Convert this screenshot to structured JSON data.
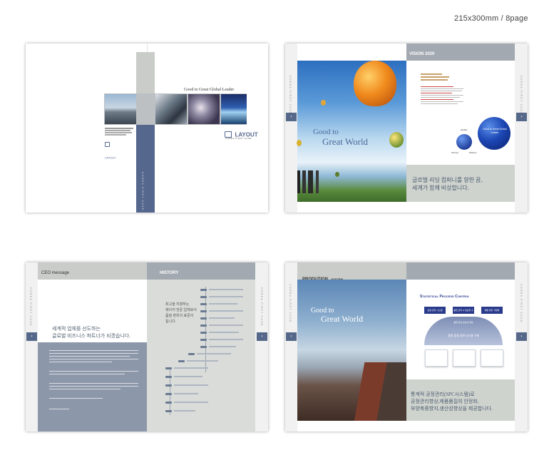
{
  "spec_label": "215x300mm / 8page",
  "cover": {
    "headline": "Good to Great Global Leader",
    "logo": "LAYOUT",
    "logo_sub": "KOREA FIRST CASE",
    "accent": "#4f5f86"
  },
  "vision": {
    "tab": "VISION 2020",
    "hero_line1": "Good to",
    "hero_line2": "Great World",
    "tagline_line1": "글로벌 리딩 컴퍼니를 향한 꿈,",
    "tagline_line2": "세계가 함께 비상합니다.",
    "circle_label": "Good to Great Global Leader",
    "small_labels": [
      "Quality",
      "Service",
      "Passion"
    ]
  },
  "ceo": {
    "tab_left": "CEO message",
    "tab_right": "HISTORY",
    "headline_line1": "세계적 업체를 선도하는",
    "headline_line2": "글로벌 비즈니스 파트너가 되겠습니다.",
    "history_line1": "최고을 지향하는",
    "history_line2": "제이지 전문 업체로서",
    "history_line3": "품질 본위의 표준이",
    "history_line4": "됩니다."
  },
  "production": {
    "tab": "PRODUTION",
    "tab_small": "SYSTEM",
    "hero_line1": "Good to",
    "hero_line2": "Great World",
    "diagram_title": "Statistical Process Control",
    "boxes": [
      "공정 관리 시스템",
      "품질 관리 & 정보화 구축",
      "재발 방지 기법화"
    ],
    "band1": "품질 향상 생산성 향상",
    "band2": "품질 품질 정보시스템 구축",
    "body_line1": "통계적 공정관리(SPC시스템)로",
    "body_line2": "공정관리향상,제품품질의 안정화,",
    "body_line3": "부양축중향지,생산성향상을 제공합니다."
  },
  "side_label": "KOREA FIRST CASE"
}
